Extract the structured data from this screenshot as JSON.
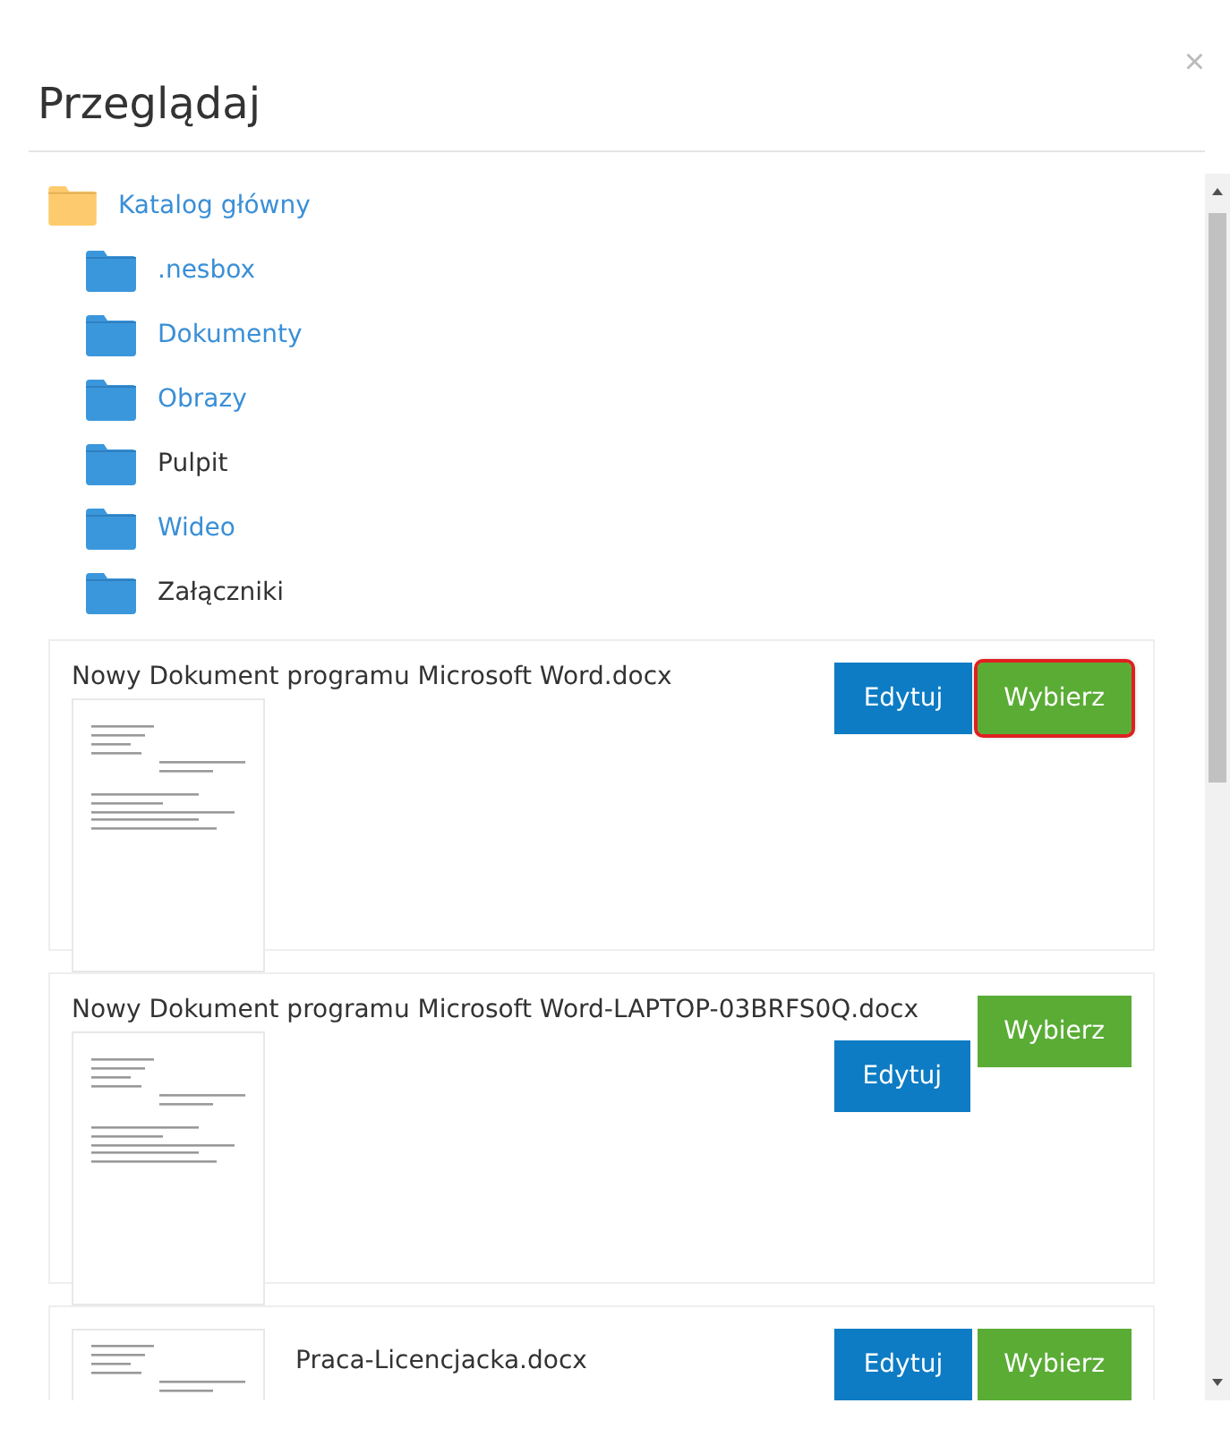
{
  "dialog": {
    "title": "Przeglądaj",
    "close": "×"
  },
  "tree": {
    "label": "Katalog główny",
    "children": [
      {
        "label": ".nesbox",
        "kind": "link"
      },
      {
        "label": "Dokumenty",
        "kind": "link"
      },
      {
        "label": "Obrazy",
        "kind": "link"
      },
      {
        "label": "Pulpit",
        "kind": "plain"
      },
      {
        "label": "Wideo",
        "kind": "link"
      },
      {
        "label": "Załączniki",
        "kind": "plain"
      }
    ]
  },
  "files": [
    {
      "name": "Nowy Dokument programu Microsoft Word.docx",
      "kind": "preview-below",
      "wrapped": false,
      "buttons": [
        {
          "label": "Edytuj",
          "kind": "edit",
          "focused": false
        },
        {
          "label": "Wybierz",
          "kind": "select",
          "focused": true
        }
      ]
    },
    {
      "name": "Nowy Dokument programu Microsoft Word-LAPTOP-03BRFS0Q.docx",
      "kind": "preview-below",
      "wrapped": true,
      "buttons": [
        {
          "label": "Edytuj",
          "kind": "edit",
          "focused": false
        },
        {
          "label": "Wybierz",
          "kind": "select",
          "focused": false
        }
      ]
    },
    {
      "name": "Praca-Licencjacka.docx",
      "kind": "preview-beside",
      "wrapped": false,
      "buttons": [
        {
          "label": "Edytuj",
          "kind": "edit",
          "focused": false
        },
        {
          "label": "Wybierz",
          "kind": "select",
          "focused": false
        }
      ]
    }
  ]
}
